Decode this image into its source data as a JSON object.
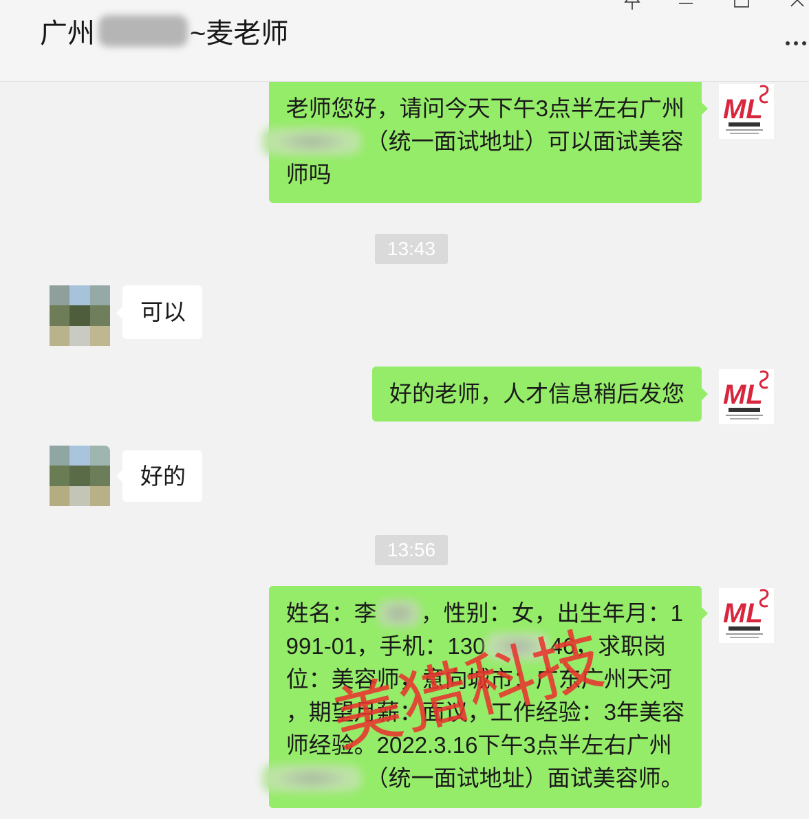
{
  "window": {
    "title_prefix": "广州",
    "title_suffix": "~麦老师",
    "icons": {
      "pin": "pin-icon",
      "minimize": "minimize-icon",
      "maximize": "maximize-icon",
      "close": "close-icon",
      "more": "more-icon"
    }
  },
  "colors": {
    "window_background": "#f2f2f2",
    "header_background": "#f5f5f5",
    "outgoing_bubble": "#95ec69",
    "incoming_bubble": "#ffffff",
    "timestamp_chip": "#dadada",
    "watermark": "#e8342e",
    "logo_red": "#d7263d"
  },
  "my_avatar": {
    "logo_lettering": "ML"
  },
  "messages": [
    {
      "outgoing": true,
      "lines": [
        [
          "老师您好，请问今天下午3点半左右广州"
        ],
        [
          "（统一面试地址）可以面试美容"
        ],
        [
          "师吗"
        ]
      ]
    },
    {
      "timestamp": "13:43"
    },
    {
      "outgoing": false,
      "lines": [
        [
          "可以"
        ]
      ]
    },
    {
      "outgoing": true,
      "lines": [
        [
          "好的老师，人才信息稍后发您"
        ]
      ]
    },
    {
      "outgoing": false,
      "lines": [
        [
          "好的"
        ]
      ]
    },
    {
      "timestamp": "13:56"
    },
    {
      "outgoing": true,
      "lines": [
        [
          "姓名：李",
          "，性别：女，出生年月：1"
        ],
        [
          "991-01，手机：130",
          "46，求职岗"
        ],
        [
          "位：美容师，意向城市：广东广州天河"
        ],
        [
          "，期望月薪：面议，工作经验：3年美容"
        ],
        [
          "师经验。2022.3.16下午3点半左右广州"
        ],
        [
          "（统一面试地址）面试美容师。"
        ]
      ]
    }
  ],
  "watermark": "美猎科技"
}
